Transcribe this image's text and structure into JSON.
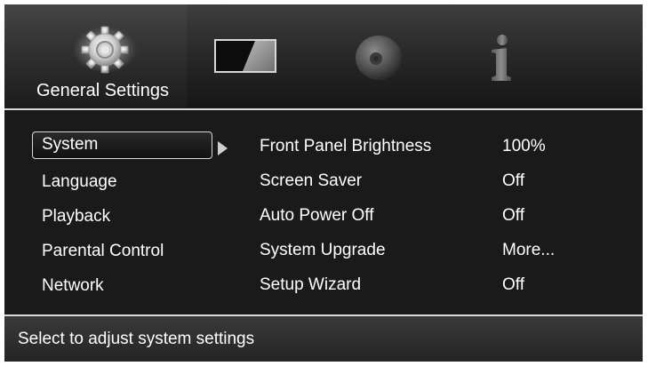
{
  "tabs": [
    {
      "label": "General Settings",
      "icon": "gear-icon"
    },
    {
      "label": "",
      "icon": "display-icon"
    },
    {
      "label": "",
      "icon": "disc-icon"
    },
    {
      "label": "",
      "icon": "info-icon"
    }
  ],
  "menu": {
    "items": [
      {
        "label": "System"
      },
      {
        "label": "Language"
      },
      {
        "label": "Playback"
      },
      {
        "label": "Parental Control"
      },
      {
        "label": "Network"
      }
    ],
    "selected": "System"
  },
  "settings": [
    {
      "name": "Front Panel Brightness",
      "value": "100%"
    },
    {
      "name": "Screen Saver",
      "value": "Off"
    },
    {
      "name": "Auto Power Off",
      "value": "Off"
    },
    {
      "name": "System Upgrade",
      "value": "More..."
    },
    {
      "name": "Setup Wizard",
      "value": "Off"
    }
  ],
  "status": {
    "text": "Select to adjust system settings"
  },
  "colors": {
    "background": "#1b1b1b",
    "text": "#ffffff",
    "divider": "#d9d9d9"
  }
}
